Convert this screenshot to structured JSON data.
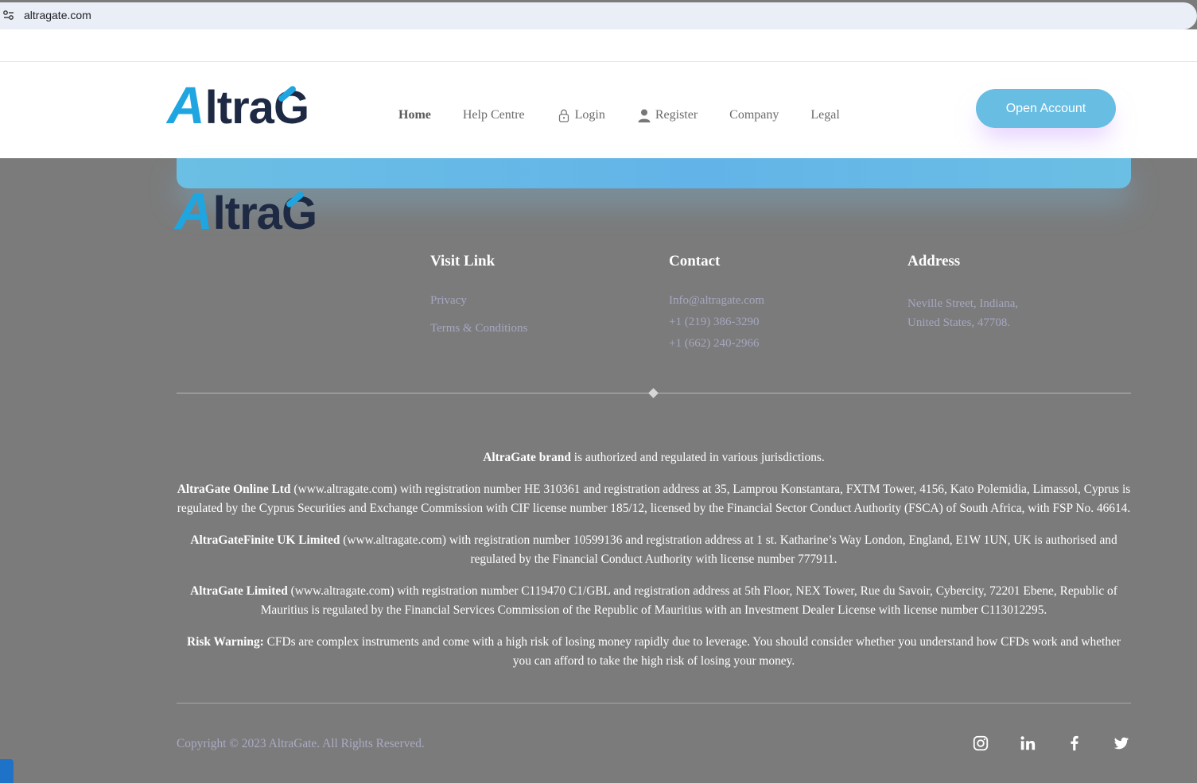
{
  "browser": {
    "url": "altragate.com",
    "site_icon": "tune-icon"
  },
  "brand": {
    "logo_a": "A",
    "logo_ltra": "ltra",
    "logo_g": "G",
    "accent": "#1fa6e0",
    "dark": "#1e2a43"
  },
  "nav": {
    "items": [
      {
        "label": "Home",
        "icon": ""
      },
      {
        "label": "Help Centre",
        "icon": ""
      },
      {
        "label": "Login",
        "icon": "lock-icon"
      },
      {
        "label": "Register",
        "icon": "user-icon"
      },
      {
        "label": "Company",
        "icon": ""
      },
      {
        "label": "Legal",
        "icon": ""
      }
    ],
    "open_account": "Open Account"
  },
  "footer": {
    "visit": {
      "title": "Visit Link",
      "links": [
        "Privacy",
        "Terms & Conditions"
      ]
    },
    "contact": {
      "title": "Contact",
      "items": [
        "Info@altragate.com",
        "+1 (219) 386-3290",
        "+1 (662) 240-2966"
      ]
    },
    "address": {
      "title": "Address",
      "lines": [
        "Neville Street, Indiana,",
        "United States, 47708."
      ]
    }
  },
  "legal": {
    "p1_bold": "AltraGate brand",
    "p1_text": " is authorized and regulated in various jurisdictions.",
    "p2_bold": "AltraGate Online Ltd",
    "p2_text": " (www.altragate.com) with registration number HE 310361 and registration address at 35, Lamprou Konstantara, FXTM Tower, 4156, Kato Polemidia, Limassol, Cyprus is regulated by the Cyprus Securities and Exchange Commission with CIF license number 185/12, licensed by the Financial Sector Conduct Authority (FSCA) of South Africa, with FSP No. 46614.",
    "p3_bold": "AltraGateFinite UK Limited",
    "p3_text": " (www.altragate.com) with registration number 10599136 and registration address at 1 st. Katharine’s Way London, England, E1W 1UN, UK is authorised and regulated by the Financial Conduct Authority with license number 777911.",
    "p4_bold": "AltraGate Limited",
    "p4_text": " (www.altragate.com) with registration number C119470 C1/GBL and registration address at 5th Floor, NEX Tower, Rue du Savoir, Cybercity, 72201 Ebene, Republic of Mauritius is regulated by the Financial Services Commission of the Republic of Mauritius with an Investment Dealer License with license number C113012295.",
    "p5_bold": "Risk Warning:",
    "p5_text": " CFDs are complex instruments and come with a high risk of losing money rapidly due to leverage. You should consider whether you understand how CFDs work and whether you can afford to take the high risk of losing your money."
  },
  "copyright": "Copyright © 2023 AltraGate. All Rights Reserved.",
  "socials": [
    "instagram-icon",
    "linkedin-icon",
    "facebook-icon",
    "twitter-icon"
  ]
}
